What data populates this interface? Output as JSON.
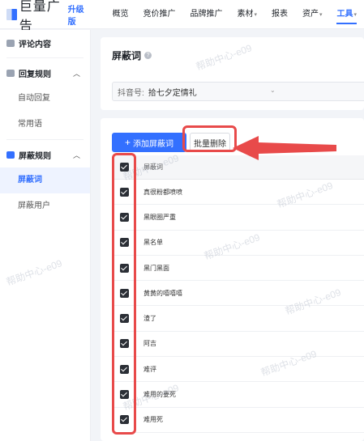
{
  "brand": {
    "name": "巨量广告",
    "badge": "升级版"
  },
  "nav": [
    {
      "label": "概览",
      "caret": ""
    },
    {
      "label": "竞价推广",
      "caret": ""
    },
    {
      "label": "品牌推广",
      "caret": ""
    },
    {
      "label": "素材",
      "caret": "▾"
    },
    {
      "label": "报表",
      "caret": ""
    },
    {
      "label": "资产",
      "caret": "▾"
    },
    {
      "label": "工具",
      "caret": "▾"
    }
  ],
  "sidebar": {
    "group1": "评论内容",
    "group2": "回复规则",
    "group2_items": [
      "自动回复",
      "常用语"
    ],
    "group3": "屏蔽规则",
    "group3_items": [
      "屏蔽词",
      "屏蔽用户"
    ]
  },
  "page": {
    "title": "屏蔽词",
    "help": "?",
    "account_label": "抖音号:",
    "account_value": "拾七夕定情礼",
    "dropdown": "⌄"
  },
  "toolbar": {
    "add_label": "添加屏蔽词",
    "add_plus": "+",
    "batch_delete_label": "批量删除"
  },
  "table": {
    "header": "屏蔽词",
    "rows": [
      "真很粉都喷喷",
      "黑眼圈严重",
      "黑名单",
      "黑门黑面",
      "黄黄的嘻嘻嘻",
      "渣了",
      "阿吉",
      "难评",
      "难用的要死",
      "难用死"
    ]
  },
  "watermark": "帮助中心-e09"
}
